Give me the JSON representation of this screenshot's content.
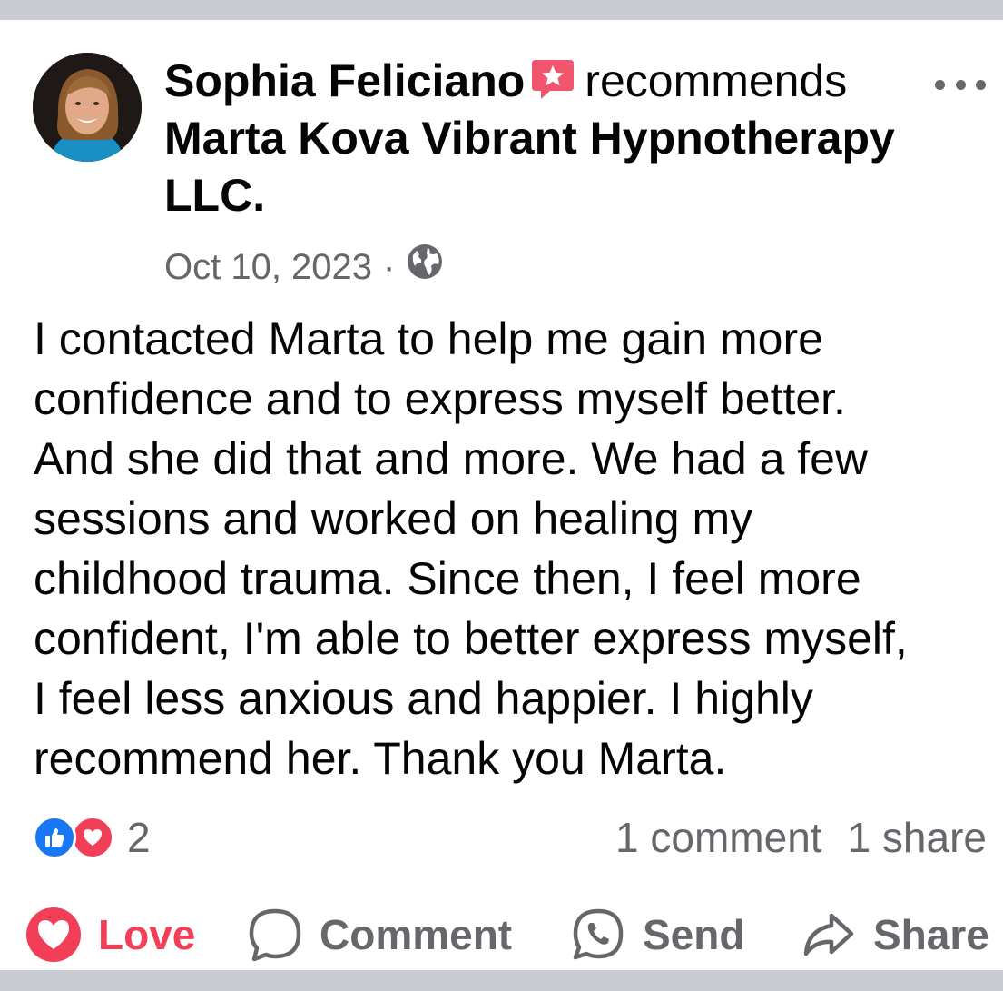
{
  "post": {
    "author": "Sophia Feliciano",
    "verb": "recommends",
    "page_name": "Marta Kova Vibrant Hypnotherapy LLC",
    "page_suffix": ".",
    "date": "Oct 10, 2023",
    "separator": "·",
    "privacy_icon": "globe-icon",
    "body": "I contacted Marta to help me gain more\nconfidence and to express myself better.\nAnd she did that and more. We had a few\nsessions and worked on healing my\nchildhood trauma. Since then, I feel more\nconfident, I'm able to better express myself,\nI feel less anxious and happier. I highly\nrecommend her. Thank you Marta."
  },
  "reactions": {
    "count": "2",
    "icons": [
      "like-icon",
      "love-icon"
    ]
  },
  "stats": {
    "comments": "1 comment",
    "shares": "1 share"
  },
  "actions": {
    "love": "Love",
    "comment": "Comment",
    "send": "Send",
    "share": "Share"
  },
  "colors": {
    "love": "#f33e58",
    "like": "#1877f2",
    "secondary_text": "#65676b",
    "recommend_badge": "#f0566d"
  }
}
